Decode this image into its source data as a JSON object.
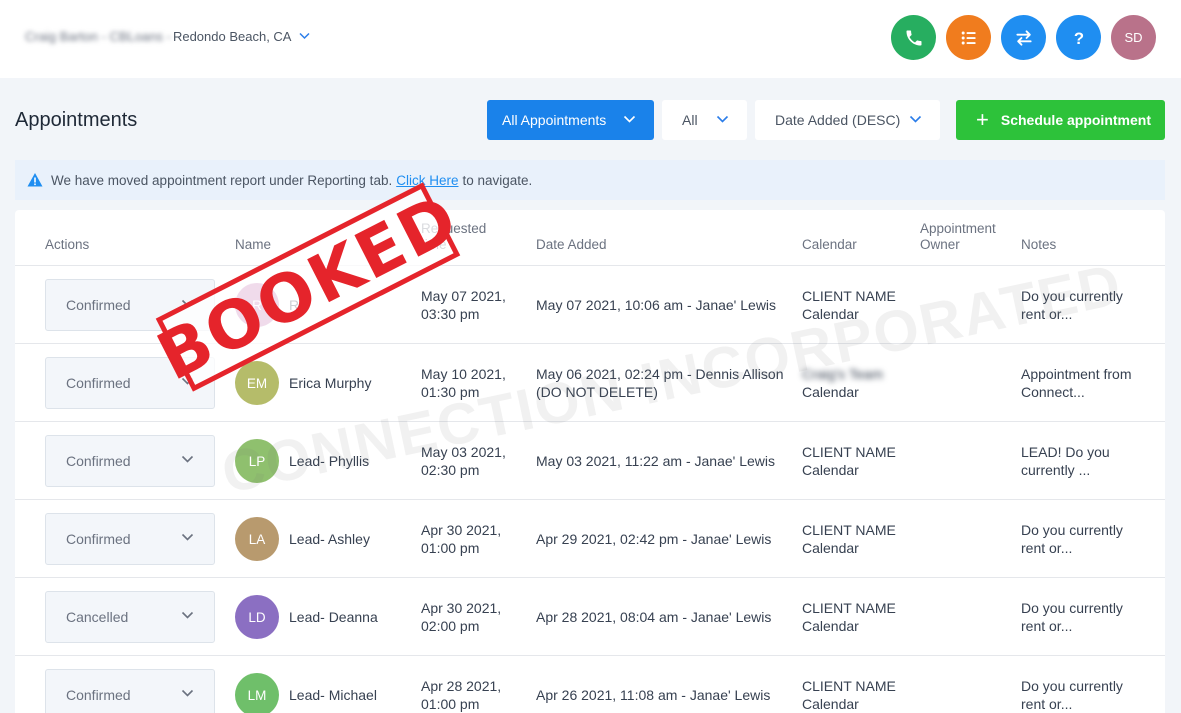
{
  "topbar": {
    "account_blurred": "Craig Barton - CBLoans -",
    "account_location": "Redondo Beach, CA",
    "avatar_initials": "SD",
    "icons": [
      "phone-icon",
      "list-icon",
      "switch-icon",
      "help-icon"
    ],
    "colors": {
      "phone": "#27ae60",
      "list": "#f07c1e",
      "switch": "#1f8ef1",
      "help": "#1f8ef1",
      "avatar": "#b9728a"
    }
  },
  "header": {
    "title": "Appointments",
    "filter_label": "All Appointments",
    "status_filter": "All",
    "sort_label": "Date Added (DESC)",
    "schedule_label": "Schedule appointment"
  },
  "notice": {
    "text_before": "We have moved appointment report under Reporting tab.",
    "link": "Click Here",
    "text_after": "to navigate."
  },
  "table": {
    "columns": {
      "actions": "Actions",
      "name": "Name",
      "requested_1": "Requested",
      "requested_2": "time",
      "date_added": "Date Added",
      "calendar": "Calendar",
      "owner_1": "Appointment",
      "owner_2": "Owner",
      "notes": "Notes"
    },
    "rows": [
      {
        "status": "Confirmed",
        "initials": "R",
        "avatar_color": "#c46fb0",
        "name": "Ro",
        "req1": "May 07 2021,",
        "req2": "03:30 pm",
        "added1": "May 07 2021, 10:06 am - Janae' Lewis",
        "added2": "",
        "cal1": "CLIENT NAME",
        "cal2": "Calendar",
        "notes1": "Do you currently",
        "notes2": "rent or..."
      },
      {
        "status": "Confirmed",
        "initials": "EM",
        "avatar_color": "#b5bc6a",
        "name": "Erica Murphy",
        "req1": "May 10 2021,",
        "req2": "01:30 pm",
        "added1": "May 06 2021, 02:24 pm - Dennis Allison",
        "added2": "(DO NOT DELETE)",
        "cal1": "Craig's Team",
        "cal2": "Calendar",
        "notes1": "Appointment from",
        "notes2": "Connect..."
      },
      {
        "status": "Confirmed",
        "initials": "LP",
        "avatar_color": "#8fc06e",
        "name": "Lead- Phyllis",
        "req1": "May 03 2021,",
        "req2": "02:30 pm",
        "added1": "May 03 2021, 11:22 am - Janae' Lewis",
        "added2": "",
        "cal1": "CLIENT NAME",
        "cal2": "Calendar",
        "notes1": "LEAD! Do you",
        "notes2": "currently ..."
      },
      {
        "status": "Confirmed",
        "initials": "LA",
        "avatar_color": "#b89a6e",
        "name": "Lead- Ashley",
        "req1": "Apr 30 2021,",
        "req2": "01:00 pm",
        "added1": "Apr 29 2021, 02:42 pm - Janae' Lewis",
        "added2": "",
        "cal1": "CLIENT NAME",
        "cal2": "Calendar",
        "notes1": "Do you currently",
        "notes2": "rent or..."
      },
      {
        "status": "Cancelled",
        "initials": "LD",
        "avatar_color": "#8b6fc2",
        "name": "Lead- Deanna",
        "req1": "Apr 30 2021,",
        "req2": "02:00 pm",
        "added1": "Apr 28 2021, 08:04 am - Janae' Lewis",
        "added2": "",
        "cal1": "CLIENT NAME",
        "cal2": "Calendar",
        "notes1": "Do you currently",
        "notes2": "rent or..."
      },
      {
        "status": "Confirmed",
        "initials": "LM",
        "avatar_color": "#6fbf6a",
        "name": "Lead- Michael",
        "req1": "Apr 28 2021,",
        "req2": "01:00 pm",
        "added1": "Apr 26 2021, 11:08 am - Janae' Lewis",
        "added2": "",
        "cal1": "CLIENT NAME",
        "cal2": "Calendar",
        "notes1": "Do you currently",
        "notes2": "rent or..."
      }
    ]
  },
  "overlay": {
    "stamp": "BOOKED",
    "watermark": "CONNECTION INCORPORATED"
  }
}
